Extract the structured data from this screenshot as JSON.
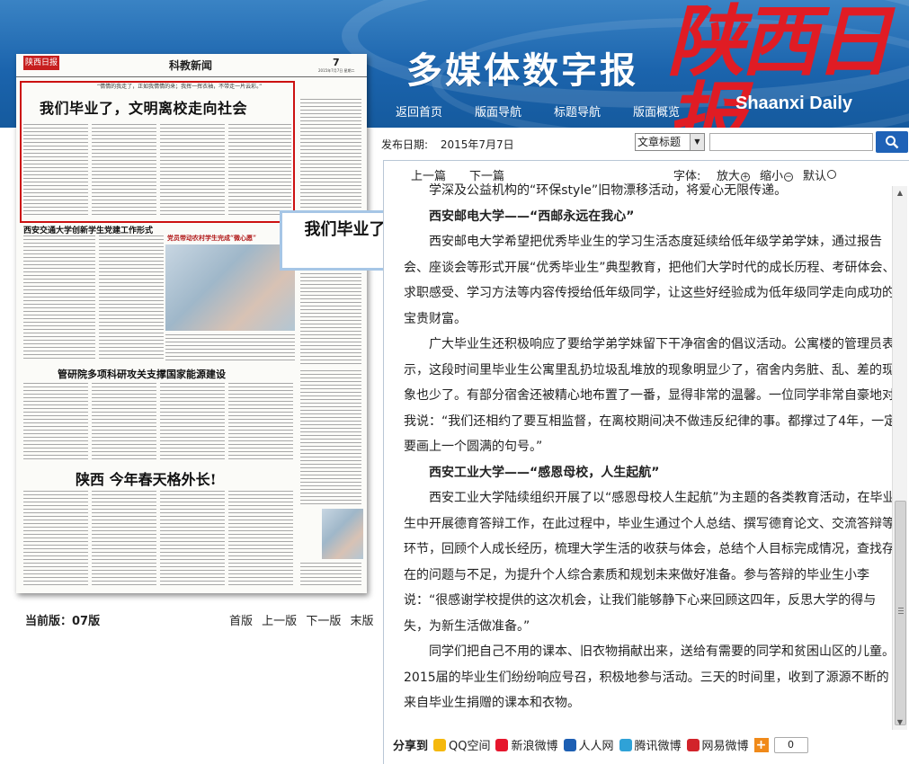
{
  "header": {
    "brand_title": "多媒体数字报",
    "logo_cn": "陕西日报",
    "logo_en": "Shaanxi Daily",
    "nav": [
      "返回首页",
      "版面导航",
      "标题导航",
      "版面概览"
    ]
  },
  "paper": {
    "logo": "陕西日报",
    "section": "科教新闻",
    "page_number": "7",
    "date": "2015年7月7日 星期二",
    "quote": "“情情的我走了，正如我情情的来；我挥一挥衣袖，不带走一片云彩。”",
    "headline": "我们毕业了，文明离校走向社会",
    "h2_a": "西安交通大学创新学生党建工作形式",
    "h2_b": "管研院多项科研攻关支撑国家能源建设",
    "h2_c": "陕西 今年春天格外长!",
    "photo_caption": "党员带动农村学生完成“微心愿”"
  },
  "tooltip": {
    "text": "我们毕业了，文明离校走向社会"
  },
  "page_controls": {
    "current_edition": "当前版：07版",
    "first": "首版",
    "prev": "上一版",
    "next": "下一版",
    "last": "末版"
  },
  "search": {
    "date_label": "发布日期:",
    "date_value": "2015年7月7日",
    "select_value": "文章标题"
  },
  "toolbar": {
    "prev": "上一篇",
    "next": "下一篇",
    "font_label": "字体:",
    "enlarge": "放大",
    "shrink": "缩小",
    "default": "默认"
  },
  "article": {
    "paragraphs": [
      {
        "type": "p",
        "text": "学深及公益机构的“环保style”旧物漂移活动，将爱心无限传递。"
      },
      {
        "type": "sub",
        "text": "西安邮电大学——“西邮永远在我心”"
      },
      {
        "type": "p",
        "text": "西安邮电大学希望把优秀毕业生的学习生活态度延续给低年级学弟学妹，通过报告会、座谈会等形式开展“优秀毕业生”典型教育，把他们大学时代的成长历程、考研体会、求职感受、学习方法等内容传授给低年级同学，让这些好经验成为低年级同学走向成功的宝贵财富。"
      },
      {
        "type": "p",
        "text": "广大毕业生还积极响应了要给学弟学妹留下干净宿舍的倡议活动。公寓楼的管理员表示，这段时间里毕业生公寓里乱扔垃圾乱堆放的现象明显少了，宿舍内务脏、乱、差的现象也少了。有部分宿舍还被精心地布置了一番，显得非常的温馨。一位同学非常自豪地对我说：“我们还相约了要互相监督，在离校期间决不做违反纪律的事。都撑过了4年，一定要画上一个圆满的句号。”"
      },
      {
        "type": "sub",
        "text": "西安工业大学——“感恩母校，人生起航”"
      },
      {
        "type": "p",
        "text": "西安工业大学陆续组织开展了以“感恩母校人生起航”为主题的各类教育活动，在毕业生中开展德育答辩工作，在此过程中，毕业生通过个人总结、撰写德育论文、交流答辩等环节，回顾个人成长经历，梳理大学生活的收获与体会，总结个人目标完成情况，查找存在的问题与不足，为提升个人综合素质和规划未来做好准备。参与答辩的毕业生小李说：“很感谢学校提供的这次机会，让我们能够静下心来回顾这四年，反思大学的得与失，为新生活做准备。”"
      },
      {
        "type": "p",
        "text": "同学们把自己不用的课本、旧衣物捐献出来，送给有需要的同学和贫困山区的儿童。2015届的毕业生们纷纷响应号召，积极地参与活动。三天的时间里，收到了源源不断的来自毕业生捐赠的课本和衣物。"
      }
    ]
  },
  "share": {
    "label": "分享到",
    "items": [
      {
        "name": "QQ空间",
        "color": "#f5b80c"
      },
      {
        "name": "新浪微博",
        "color": "#e6162d"
      },
      {
        "name": "人人网",
        "color": "#1d5fb3"
      },
      {
        "name": "腾讯微博",
        "color": "#2fa2d7"
      },
      {
        "name": "网易微博",
        "color": "#d2232a"
      }
    ],
    "count": "0"
  }
}
